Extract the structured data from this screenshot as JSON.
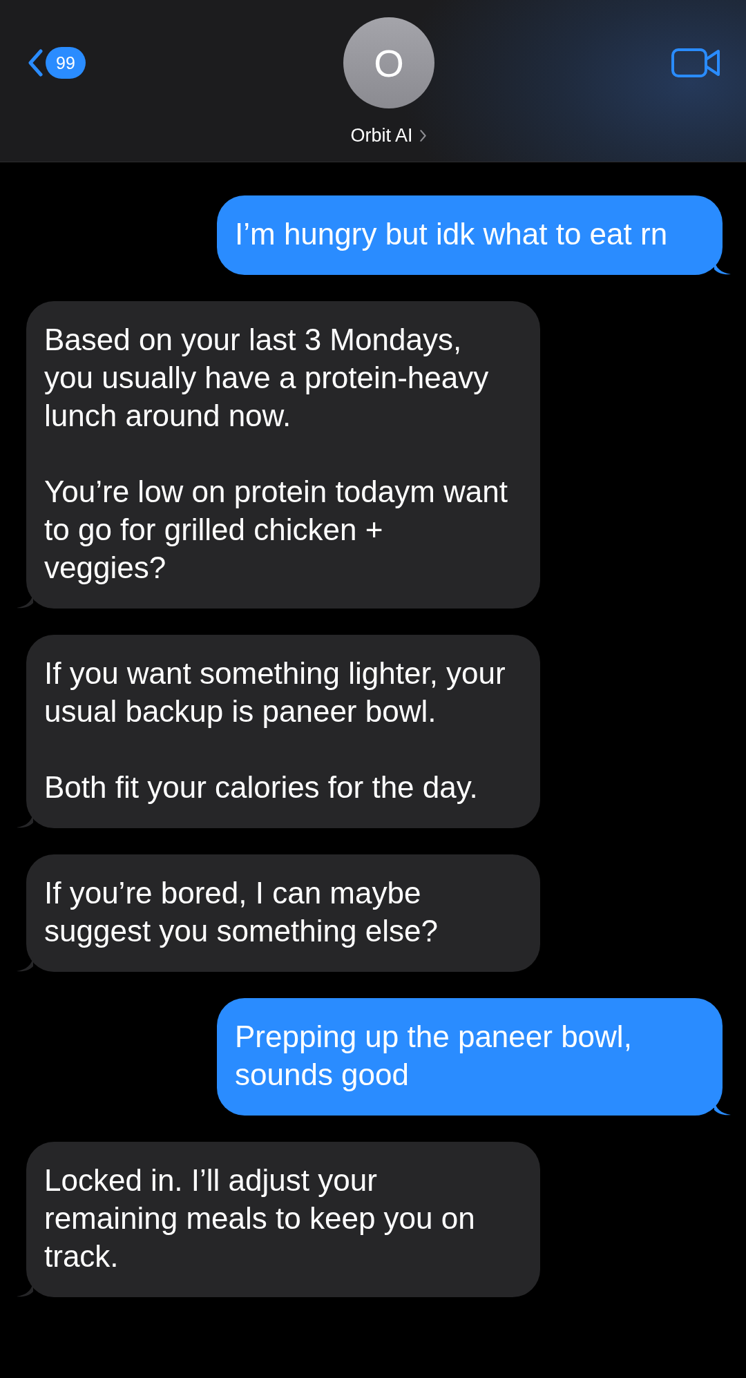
{
  "header": {
    "unread_count": "99",
    "avatar_initial": "O",
    "contact_name": "Orbit AI"
  },
  "messages": [
    {
      "kind": "outgoing",
      "text": "I’m hungry but idk what to eat rn"
    },
    {
      "kind": "incoming",
      "text": "Based on your last 3 Mondays, you usually have a protein-heavy lunch around now.\n\nYou’re low on protein todaym want to go for grilled chicken + veggies?"
    },
    {
      "kind": "incoming",
      "text": "If you want something lighter, your usual backup is paneer bowl.\n\nBoth fit your calories for the day."
    },
    {
      "kind": "incoming",
      "text": "If you’re bored, I can maybe suggest you something else?"
    },
    {
      "kind": "outgoing",
      "text": "Prepping up the paneer bowl, sounds good"
    },
    {
      "kind": "incoming",
      "text": "Locked in. I’ll adjust your remaining meals to keep you on track."
    }
  ]
}
